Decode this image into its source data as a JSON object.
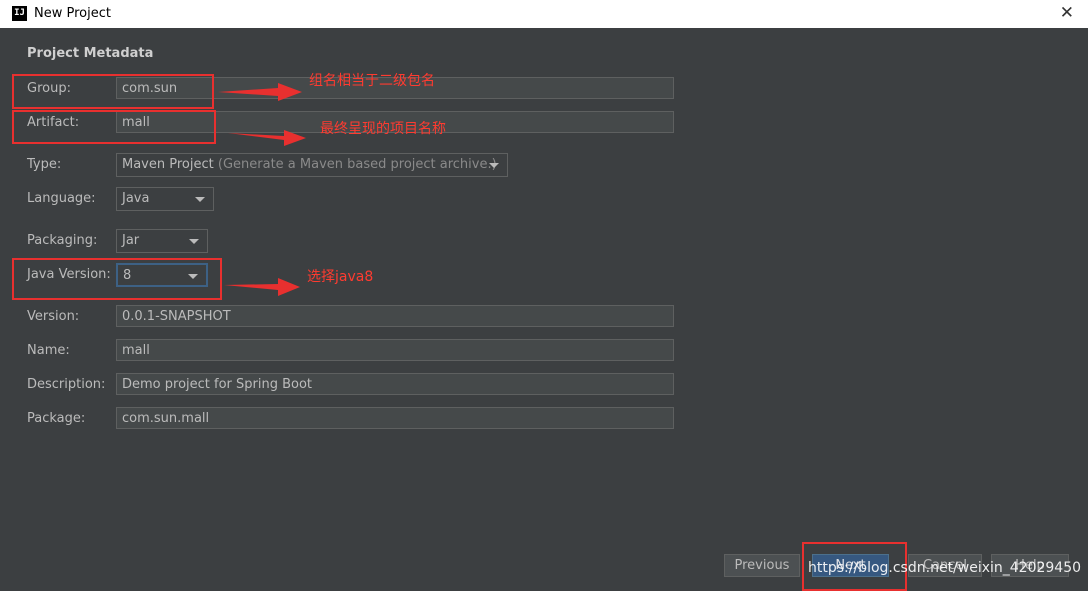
{
  "window": {
    "title": "New Project",
    "app_icon": "IJ"
  },
  "section_title": "Project Metadata",
  "fields": {
    "group": {
      "label": "Group:",
      "value": "com.sun"
    },
    "artifact": {
      "label": "Artifact:",
      "value": "mall"
    },
    "type": {
      "label": "Type:",
      "value": "Maven Project",
      "hint": "(Generate a Maven based project archive.)"
    },
    "language": {
      "label": "Language:",
      "value": "Java"
    },
    "packaging": {
      "label": "Packaging:",
      "value": "Jar"
    },
    "java_version": {
      "label": "Java Version:",
      "value": "8"
    },
    "version": {
      "label": "Version:",
      "value": "0.0.1-SNAPSHOT"
    },
    "name": {
      "label": "Name:",
      "value": "mall"
    },
    "description": {
      "label": "Description:",
      "value": "Demo project for Spring Boot"
    },
    "package": {
      "label": "Package:",
      "value": "com.sun.mall"
    }
  },
  "annotations": {
    "group_note": "组名相当于二级包名",
    "artifact_note": "最终呈现的项目名称",
    "java_note": "选择java8"
  },
  "buttons": {
    "previous": "Previous",
    "next": "Next",
    "cancel": "Cancel",
    "help": "Help"
  },
  "watermark": "https://blog.csdn.net/weixin_42029450",
  "colors": {
    "background": "#3c3f41",
    "field_bg": "#45494a",
    "accent": "#365880",
    "annotation_red": "#e8302f"
  }
}
